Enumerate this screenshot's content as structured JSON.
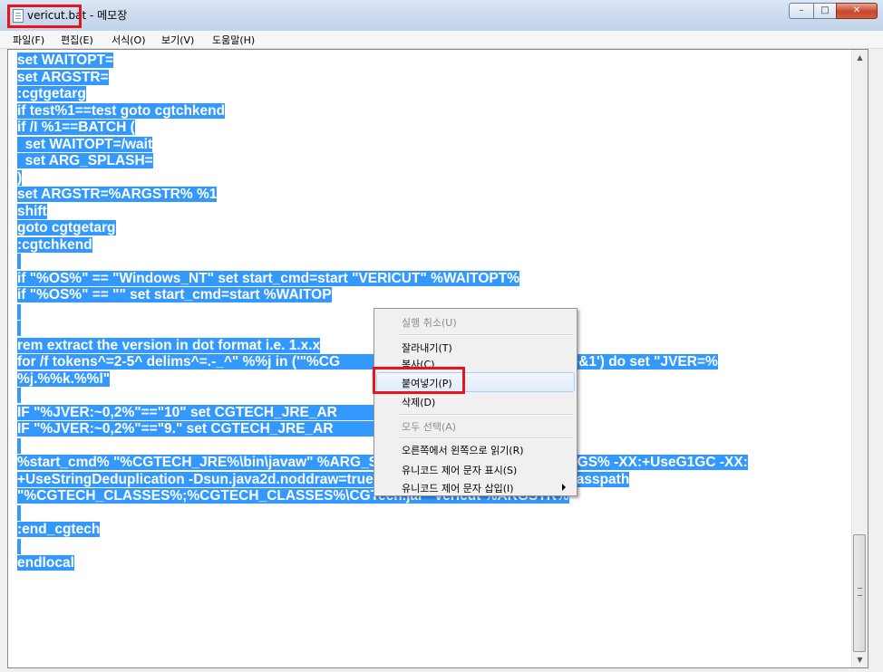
{
  "window": {
    "title": "vericut.bat - 메모장",
    "buttons": {
      "minimize": "–",
      "maximize": "□",
      "close": "✕"
    }
  },
  "menu": [
    "파일(F)",
    "편집(E)",
    "서식(O)",
    "보기(V)",
    "도움말(H)"
  ],
  "editor": {
    "lines": [
      "set WAITOPT=",
      "set ARGSTR=",
      ":cgtgetarg",
      "if test%1==test goto cgtchkend",
      "if /I %1==BATCH (",
      "  set WAITOPT=/wait",
      "  set ARG_SPLASH=",
      ")",
      "set ARGSTR=%ARGSTR% %1",
      "shift",
      "goto cgtgetarg",
      ":cgtchkend",
      "",
      "if \"%OS%\" == \"Windows_NT\" set start_cmd=start \"VERICUT\" %WAITOPT%",
      "if \"%OS%\" == \"\" set start_cmd=start %WAITOP",
      "",
      "",
      "rem extract the version in dot format i.e. 1.x.x",
      "for /f tokens^=2-5^ delims^=.-_^\" %%j in ('\"%CG                                       version 2^>^&1') do set \"JVER=%",
      "%j.%%k.%%l\"",
      "",
      "IF \"%JVER:~0,2%\"==\"10\" set CGTECH_JRE_AR                                    ml.bind",
      "IF \"%JVER:~0,2%\"==\"9.\" set CGTECH_JRE_AR                                     ml.bind",
      "",
      "%start_cmd% \"%CGTECH_JRE%\\bin\\javaw\" %ARG_SPLASH% %CGTECH_JRE_ARGS% -XX:+UseG1GC -XX:",
      "+UseStringDeduplication -Dsun.java2d.noddraw=true -Xms256m -Xmx2g -Xss6m -classpath",
      "\"%CGTECH_CLASSES%;%CGTECH_CLASSES%\\CGTech.jar\" Vericut %ARGSTR%",
      "",
      ":end_cgtech",
      "",
      "endlocal"
    ]
  },
  "context_menu": {
    "items": [
      {
        "label": "실행 취소(U)",
        "disabled": true
      },
      {
        "label": "잘라내기(T)",
        "disabled": false
      },
      {
        "label": "복사(C)",
        "disabled": false
      },
      {
        "label": "붙여넣기(P)",
        "disabled": false,
        "highlighted": true
      },
      {
        "label": "삭제(D)",
        "disabled": false
      },
      {
        "label": "모두 선택(A)",
        "disabled": true
      },
      {
        "label": "오른쪽에서 왼쪽으로 읽기(R)",
        "disabled": false
      },
      {
        "label": "유니코드 제어 문자 표시(S)",
        "disabled": false
      },
      {
        "label": "유니코드 제어 문자 삽입(I)",
        "disabled": false,
        "submenu": true
      }
    ]
  },
  "colors": {
    "selection": "#3399ff",
    "annotation": "#e8141b"
  }
}
